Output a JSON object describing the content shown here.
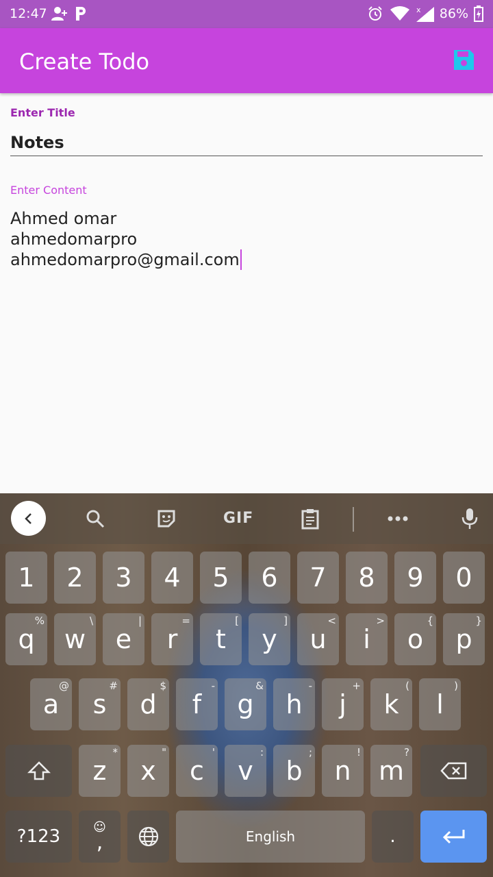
{
  "status_bar": {
    "time": "12:47",
    "battery": "86%"
  },
  "app_bar": {
    "title": "Create Todo",
    "save_icon": "save-icon",
    "accent_color": "#c644dd",
    "save_icon_color": "#1ec8ec"
  },
  "form": {
    "title_label": "Enter Title",
    "title_value": "Notes",
    "content_label": "Enter Content",
    "content_lines": [
      "Ahmed omar",
      "ahmedomarpro",
      "ahmedomarpro@gmail.com"
    ]
  },
  "keyboard": {
    "toolbar": [
      "back-icon",
      "search-icon",
      "sticker-icon",
      "gif",
      "clipboard-icon",
      "more-icon",
      "mic-icon"
    ],
    "gif_label": "GIF",
    "rows": {
      "numbers": [
        "1",
        "2",
        "3",
        "4",
        "5",
        "6",
        "7",
        "8",
        "9",
        "0"
      ],
      "row1": [
        [
          "q",
          "%"
        ],
        [
          "w",
          "\\"
        ],
        [
          "e",
          "|"
        ],
        [
          "r",
          "="
        ],
        [
          "t",
          "["
        ],
        [
          "y",
          "]"
        ],
        [
          "u",
          "<"
        ],
        [
          "i",
          ">"
        ],
        [
          "o",
          "{"
        ],
        [
          "p",
          "}"
        ]
      ],
      "row2": [
        [
          "a",
          "@"
        ],
        [
          "s",
          "#"
        ],
        [
          "d",
          "$"
        ],
        [
          "f",
          "-"
        ],
        [
          "g",
          "&"
        ],
        [
          "h",
          "-"
        ],
        [
          "j",
          "+"
        ],
        [
          "k",
          "("
        ],
        [
          "l",
          ")"
        ]
      ],
      "row3": [
        [
          "z",
          "*"
        ],
        [
          "x",
          "\""
        ],
        [
          "c",
          "'"
        ],
        [
          "v",
          ":"
        ],
        [
          "b",
          ";"
        ],
        [
          "n",
          "!"
        ],
        [
          "m",
          "?"
        ]
      ]
    },
    "symbols_label": "?123",
    "comma_label": ",",
    "space_label": "English",
    "period_label": ".",
    "enter_color": "#5b95f0"
  }
}
